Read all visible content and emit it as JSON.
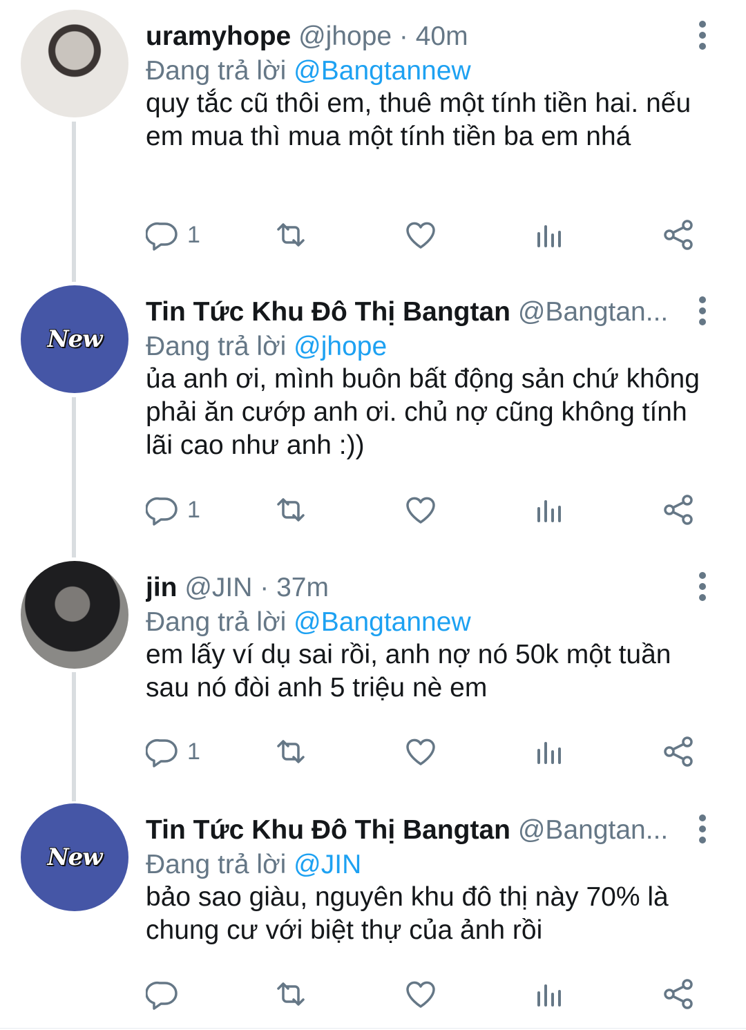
{
  "tweets": [
    {
      "name": "uramyhope",
      "handle": "@jhope",
      "time": "· 40m",
      "replying_label": "Đang trả lời",
      "replying_to": "@Bangtannew",
      "text": "quy tắc cũ thôi em, thuê một tính tiền hai. nếu em mua thì mua một tính tiền ba em nhá",
      "reply_count": "1",
      "avatar": "photo"
    },
    {
      "name": "Tin Tức Khu Đô Thị Bangtan",
      "handle": "@Bangtan...",
      "time": "",
      "replying_label": "Đang trả lời",
      "replying_to": "@jhope",
      "text": "ủa anh ơi, mình buôn bất động sản chứ không phải ăn cướp anh ơi. chủ nợ cũng không tính lãi cao như anh :))",
      "reply_count": "1",
      "avatar": "New"
    },
    {
      "name": "jin",
      "handle": "@JIN",
      "time": "· 37m",
      "replying_label": "Đang trả lời",
      "replying_to": "@Bangtannew",
      "text": "em lấy ví dụ sai rồi, anh nợ nó 50k một tuần sau nó đòi anh 5 triệu nè em",
      "reply_count": "1",
      "avatar": "photo"
    },
    {
      "name": "Tin Tức Khu Đô Thị Bangtan",
      "handle": "@Bangtan...",
      "time": "",
      "replying_label": "Đang trả lời",
      "replying_to": "@JIN",
      "text": "bảo sao giàu, nguyên khu đô thị này 70% là chung cư với biệt thự của ảnh rồi",
      "reply_count": "",
      "avatar": "New"
    }
  ],
  "icons": {
    "reply": "reply-icon",
    "retweet": "retweet-icon",
    "like": "heart-icon",
    "analytics": "analytics-icon",
    "share": "share-icon",
    "more": "more-vertical-icon"
  },
  "colors": {
    "link": "#1da1f2",
    "secondary": "#657786",
    "avatar_new_bg": "#4556a6"
  }
}
